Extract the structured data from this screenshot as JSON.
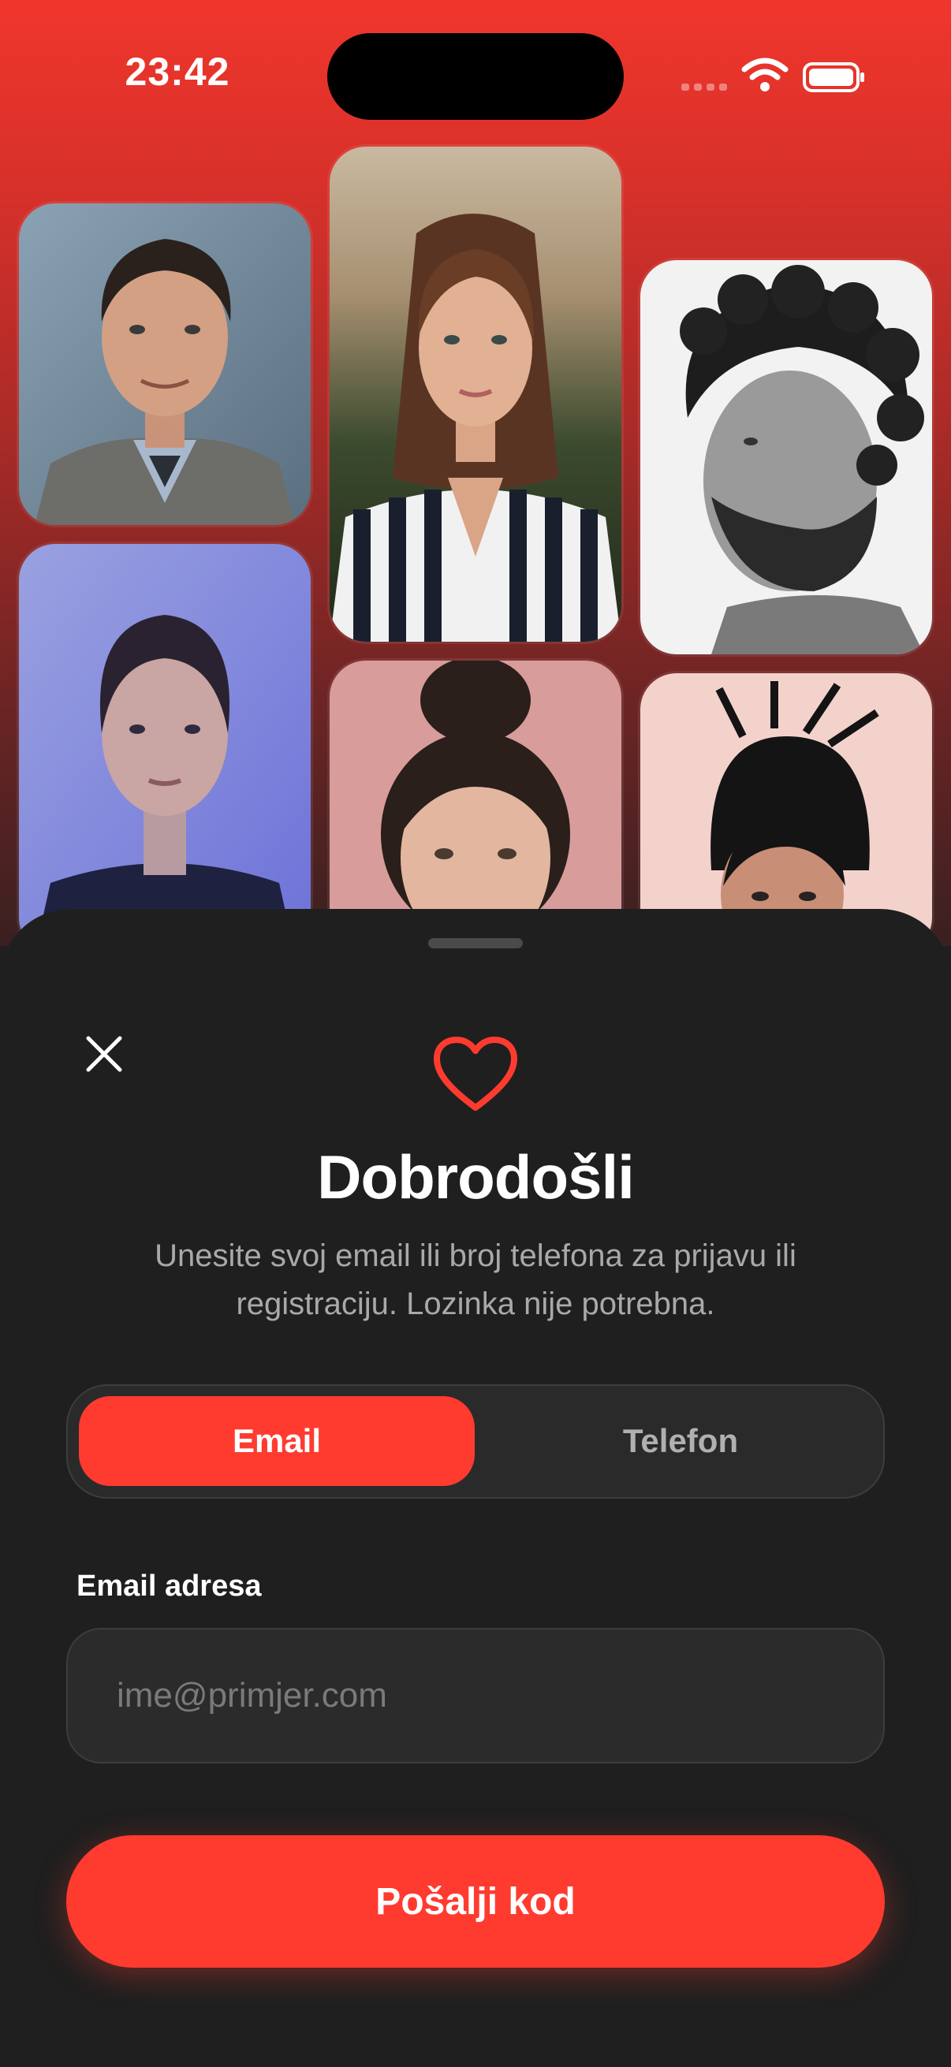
{
  "status_bar": {
    "time": "23:42",
    "icons": [
      "cellular-signal-icon",
      "wifi-icon",
      "battery-icon"
    ]
  },
  "photo_grid": {
    "photos": [
      {
        "description_icon": "portrait-photo"
      },
      {
        "description_icon": "portrait-photo"
      },
      {
        "description_icon": "portrait-photo"
      },
      {
        "description_icon": "portrait-photo"
      },
      {
        "description_icon": "portrait-photo"
      },
      {
        "description_icon": "portrait-photo"
      }
    ]
  },
  "sheet": {
    "close_icon": "close-icon",
    "logo_icon": "heart-icon",
    "title": "Dobrodošli",
    "subtitle": "Unesite svoj email ili broj telefona za prijavu ili registraciju. Lozinka nije potrebna.",
    "segment": {
      "options": [
        "Email",
        "Telefon"
      ],
      "selected": "Email"
    },
    "email_field": {
      "label": "Email adresa",
      "value": "",
      "placeholder": "ime@primjer.com"
    },
    "submit_label": "Pošalji kod"
  },
  "colors": {
    "accent": "#ff3b30",
    "sheet_background": "#1f1f1f",
    "control_background": "#2a2a2a"
  }
}
